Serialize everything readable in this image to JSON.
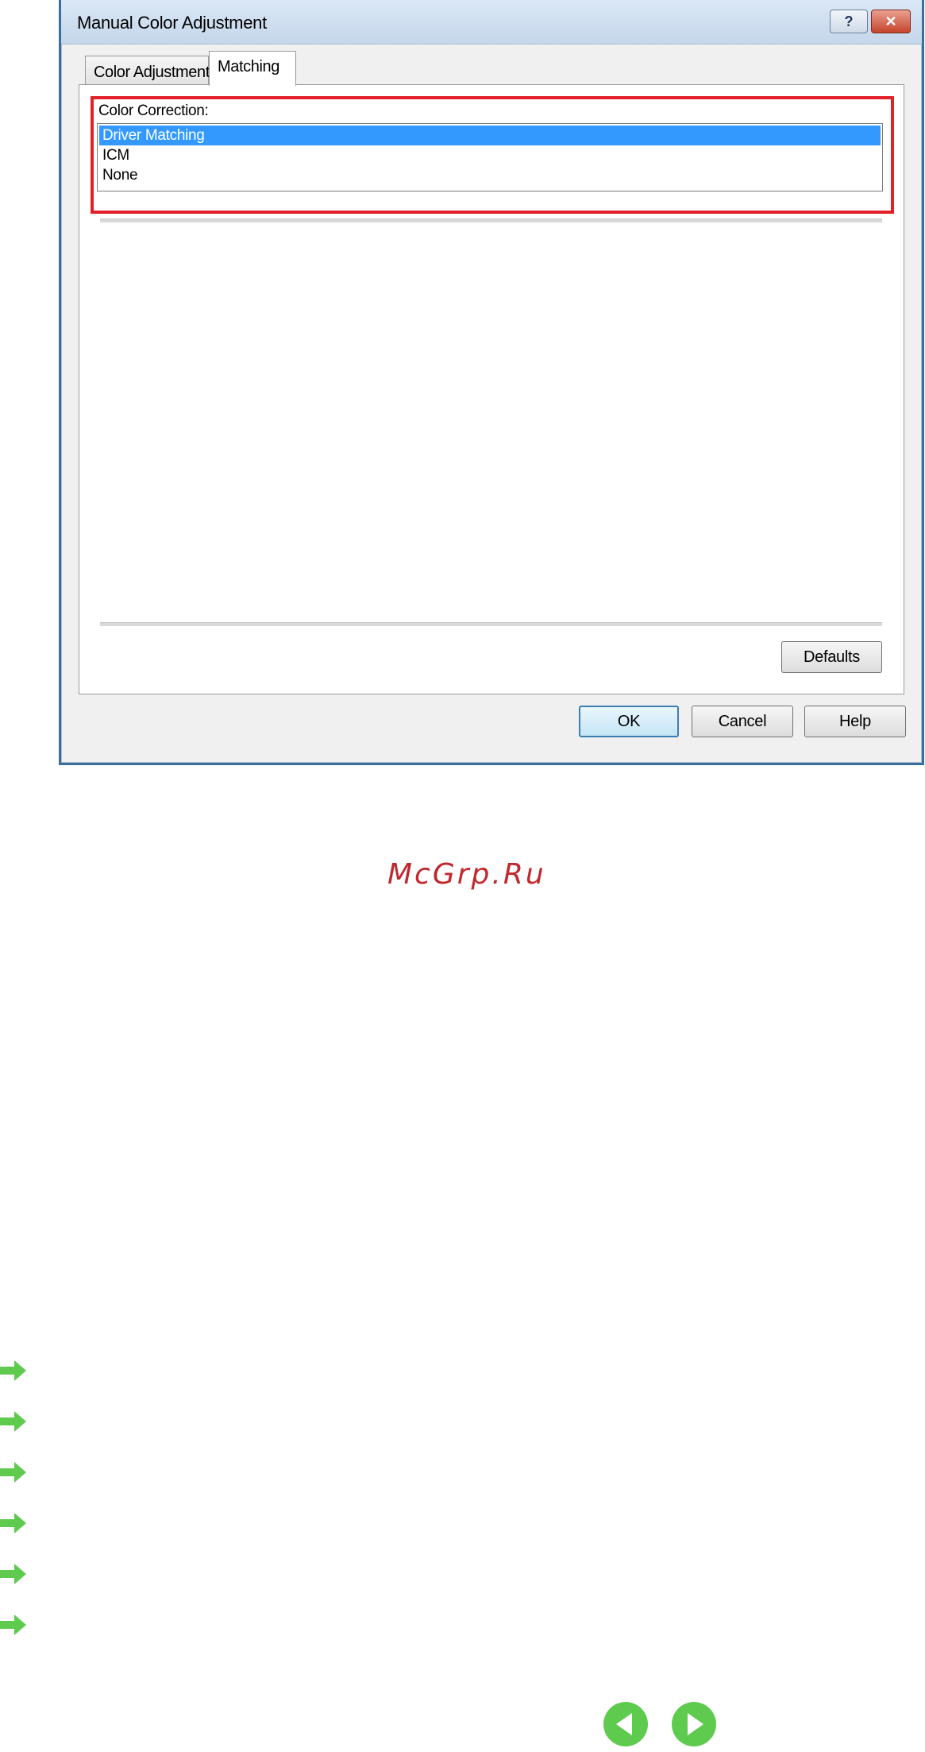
{
  "dialog": {
    "title": "Manual Color Adjustment",
    "title_help_glyph": "?",
    "title_close_glyph": "✕",
    "tabs": [
      {
        "label": "Color Adjustment",
        "active": false
      },
      {
        "label": "Matching",
        "active": true
      }
    ],
    "color_correction": {
      "label": "Color Correction:",
      "options": [
        "Driver Matching",
        "ICM",
        "None"
      ],
      "selected": "Driver Matching"
    },
    "buttons": {
      "defaults": "Defaults",
      "ok": "OK",
      "cancel": "Cancel",
      "help": "Help"
    }
  },
  "watermark": "McGrp.Ru",
  "arrow_links_count": 6,
  "colors": {
    "highlight": "#e2202a",
    "selection": "#3399ff",
    "arrow": "#5ecb4f",
    "watermark": "#c1272d"
  },
  "icons": {
    "arrow": "right-arrow-icon",
    "prev": "previous-page-icon",
    "next": "next-page-icon"
  }
}
